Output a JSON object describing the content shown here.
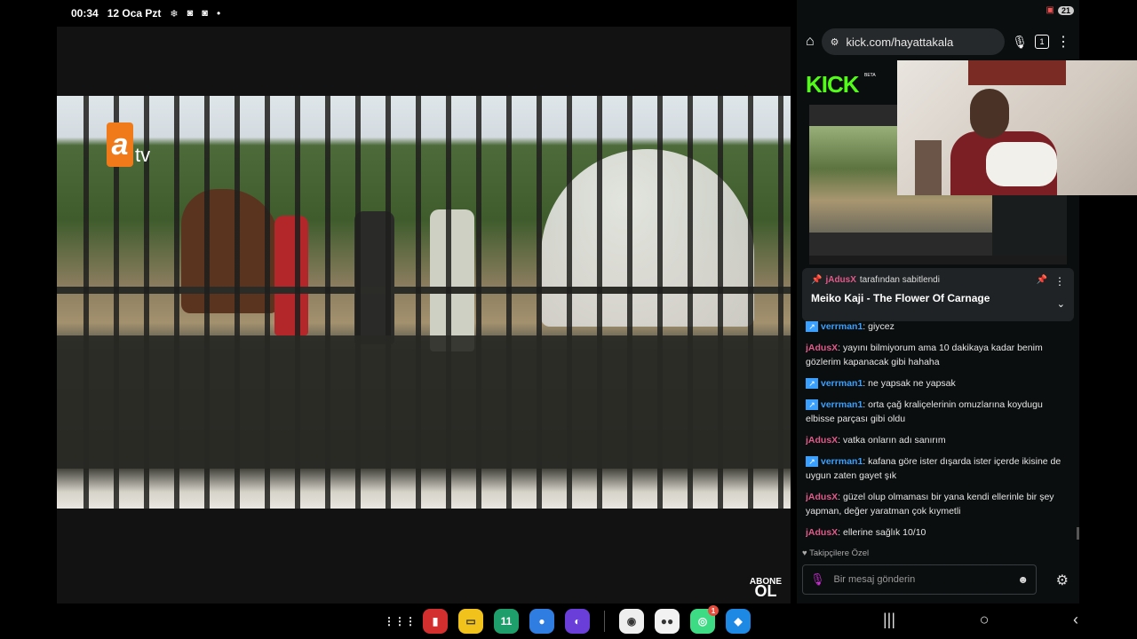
{
  "status": {
    "time": "00:34",
    "date": "12 Oca Pzt",
    "icons": [
      "snowflake-icon",
      "instagram-icon",
      "instagram-icon"
    ],
    "dot": "•"
  },
  "video": {
    "channel_logo_a": "a",
    "channel_logo_tv": "tv",
    "corner_badge_top": "ABONE",
    "corner_badge_bottom": "OL"
  },
  "browser": {
    "url": "kick.com/hayattakala",
    "tab_count": "1",
    "battery": "21"
  },
  "kick": {
    "logo": "KICK",
    "beta": "BETA"
  },
  "pinned": {
    "pinned_by_user": "jAdusX",
    "pinned_by_suffix": "tarafından sabitlendi",
    "title": "Meiko Kaji - The Flower Of Carnage"
  },
  "chat": {
    "messages": [
      {
        "user": "verrman1",
        "text": ": giycez",
        "bot": true,
        "color": "#3aa0ff"
      },
      {
        "user": "jAdusX",
        "text": ": yayını bilmiyorum ama 10 dakikaya kadar benim gözlerim kapanacak gibi hahaha",
        "bot": false,
        "color": "#e05a8a"
      },
      {
        "user": "verrman1",
        "text": ": ne yapsak ne yapsak",
        "bot": true,
        "color": "#3aa0ff"
      },
      {
        "user": "verrman1",
        "text": ": orta çağ kraliçelerinin omuzlarına koydugu elbisse parçası gibi oldu",
        "bot": true,
        "color": "#3aa0ff"
      },
      {
        "user": "jAdusX",
        "text": ": vatka onların adı sanırım",
        "bot": false,
        "color": "#e05a8a"
      },
      {
        "user": "verrman1",
        "text": ": kafana göre ister dışarda ister içerde ikisine de uygun zaten gayet şık",
        "bot": true,
        "color": "#3aa0ff"
      },
      {
        "user": "jAdusX",
        "text": ": güzel olup olmaması bir yana kendi ellerinle bir şey yapman, değer yaratman çok kıymetli",
        "bot": false,
        "color": "#e05a8a"
      },
      {
        "user": "jAdusX",
        "text": ": ellerine sağlık 10/10",
        "bot": false,
        "color": "#e05a8a"
      }
    ],
    "followers_only": "Takipçilere Özel",
    "input_placeholder": "Bir mesaj gönderin"
  },
  "dock": {
    "apps": [
      {
        "name": "app-grid-icon",
        "color": "transparent",
        "glyph": "⋮⋮⋮"
      },
      {
        "name": "red-app-icon",
        "color": "#d32f2f",
        "glyph": "▮"
      },
      {
        "name": "folder-app-icon",
        "color": "#f1c21b",
        "glyph": "▭"
      },
      {
        "name": "calendar-app-icon",
        "color": "#1e9e6a",
        "glyph": "11"
      },
      {
        "name": "messages-app-icon",
        "color": "#2f7de1",
        "glyph": "●"
      },
      {
        "name": "internet-app-icon",
        "color": "#6a3fd9",
        "glyph": "◐"
      },
      {
        "name": "camera-app-icon",
        "color": "#eeeeee",
        "glyph": "◉"
      },
      {
        "name": "duo-app-icon",
        "color": "#f2f2f2",
        "glyph": "●●"
      },
      {
        "name": "android-app-icon",
        "color": "#3ddc84",
        "glyph": "◎"
      },
      {
        "name": "store-app-icon",
        "color": "#1e88e5",
        "glyph": "◆"
      }
    ],
    "notification_badge": "1"
  }
}
